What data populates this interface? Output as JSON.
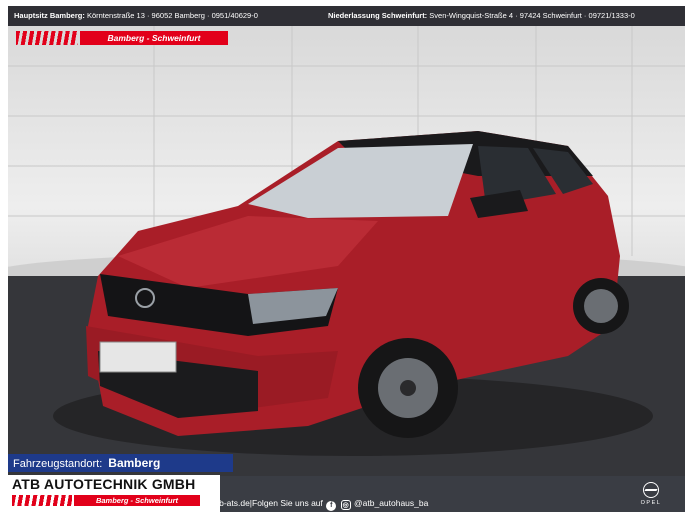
{
  "topbar": {
    "hq_label": "Hauptsitz Bamberg:",
    "hq_address": "Körntenstraße 13 · 96052 Bamberg · 0951/40629-0",
    "branch_label": "Niederlassung Schweinfurt:",
    "branch_address": "Sven-Wingquist-Straße 4 · 97424 Schweinfurt · 09721/1333-0"
  },
  "banner": {
    "label": "Bamberg - Schweinfurt"
  },
  "standort": {
    "label": "Fahrzeugstandort:",
    "city": "Bamberg"
  },
  "dealer": {
    "name": "ATB AUTOTECHNIK GMBH",
    "sub": "Bamberg - Schweinfurt"
  },
  "social": {
    "text": "atb-ats.de|Folgen Sie uns auf",
    "handle": "@atb_autohaus_ba"
  },
  "brand": {
    "word": "OPEL"
  },
  "colors": {
    "accent_red": "#e2001a",
    "location_blue": "#1e3a8a",
    "car_red": "#b0202a",
    "bar_dark": "#2f2f35"
  },
  "icons": [
    "facebook-icon",
    "instagram-icon",
    "opel-logo"
  ]
}
